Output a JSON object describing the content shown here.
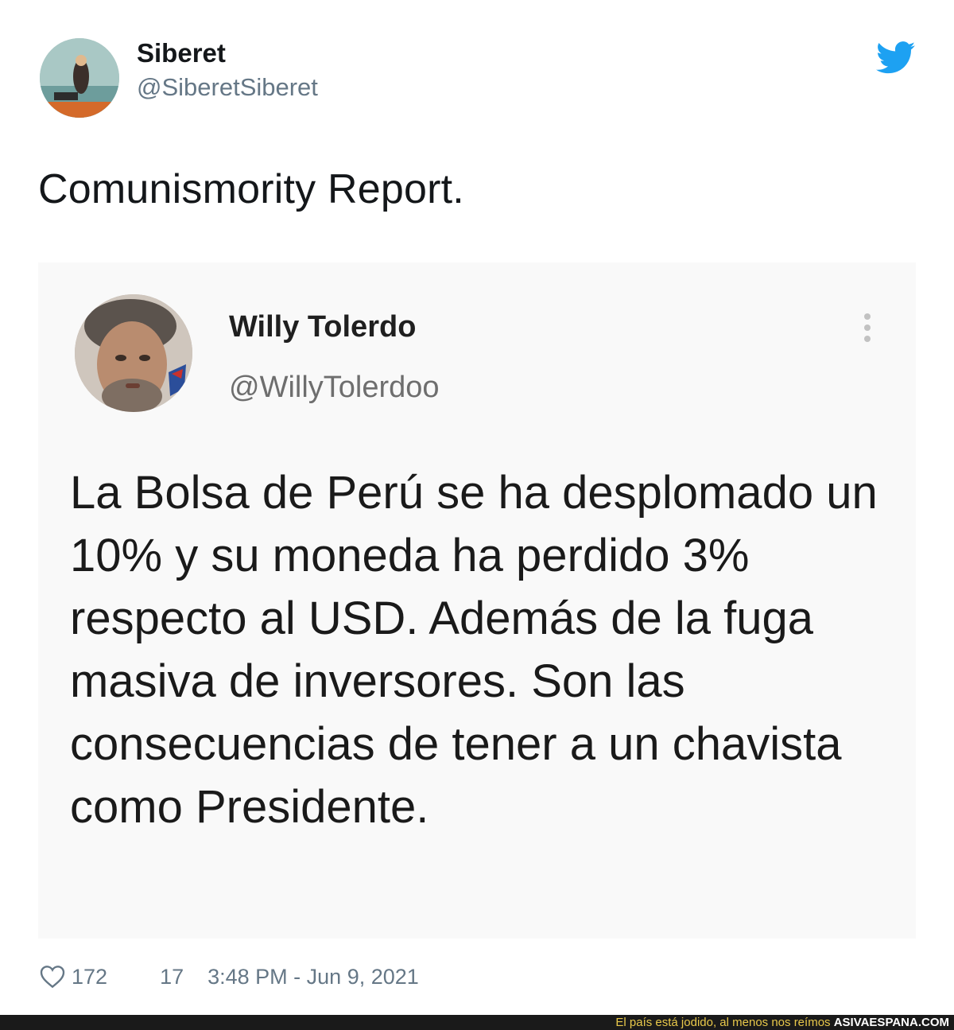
{
  "author": {
    "name": "Siberet",
    "handle": "@SiberetSiberet"
  },
  "tweet": {
    "text": "Comunismority Report."
  },
  "quoted_tweet": {
    "name": "Willy Tolerdo",
    "handle": "@WillyTolerdoo",
    "text": "La Bolsa de Perú se ha desplomado un 10% y su moneda ha perdido 3% respecto al USD. Además de la fuga masiva de inversores. Son las consecuencias de tener a un chavista como Presidente."
  },
  "footer": {
    "likes": "172",
    "retweets": "17",
    "timestamp": "3:48 PM - Jun 9, 2021"
  },
  "watermark": {
    "tagline": "El país está jodido, al menos nos reímos",
    "site": "ASIVAESPANA.COM"
  },
  "icons": {
    "logo": "twitter-bird-icon",
    "like": "heart-icon",
    "menu": "more-vertical-icon"
  },
  "colors": {
    "twitter_blue": "#1da1f2",
    "secondary_text": "#657786",
    "quoted_background": "#f9f9f9"
  }
}
